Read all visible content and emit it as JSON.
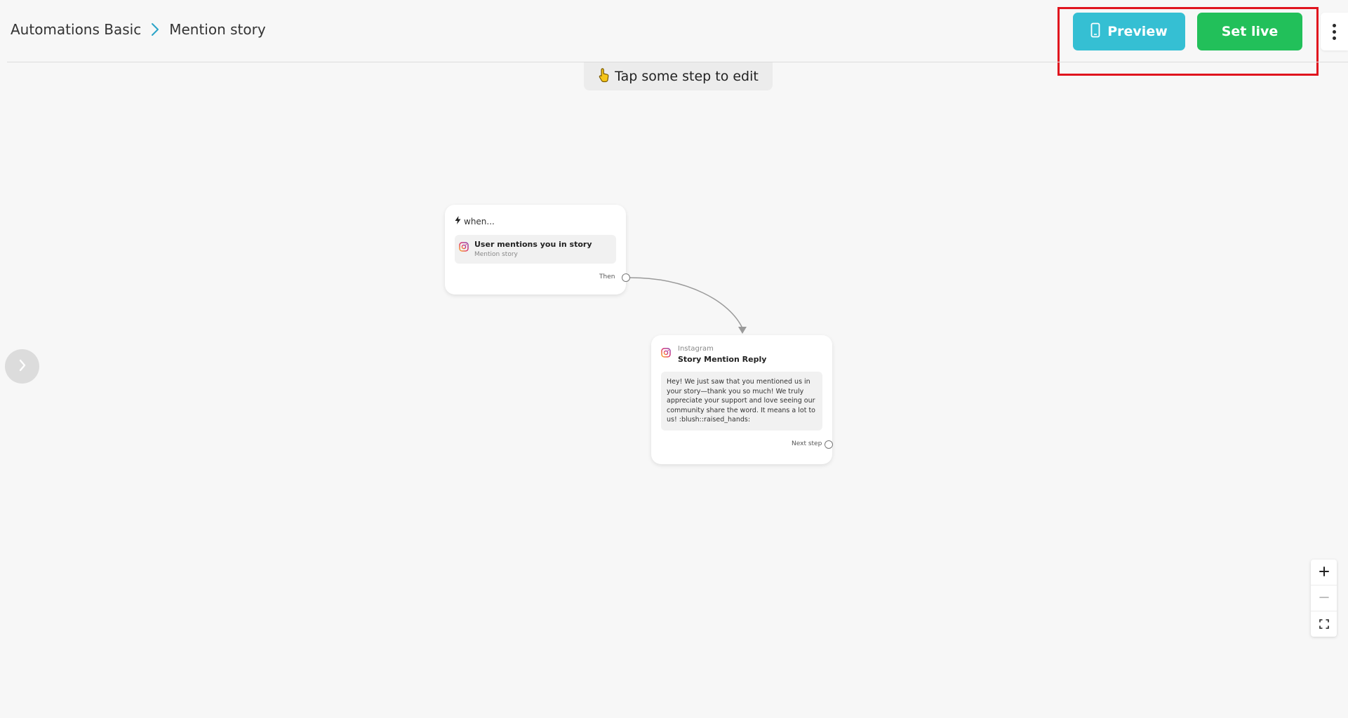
{
  "header": {
    "breadcrumb": {
      "parent": "Automations Basic",
      "current": "Mention story"
    },
    "preview_label": "Preview",
    "set_live_label": "Set live"
  },
  "canvas": {
    "hint": "Tap some step to edit",
    "trigger_card": {
      "when_label": "when...",
      "trigger_title": "User mentions you in story",
      "trigger_subtitle": "Mention story",
      "port_label": "Then"
    },
    "action_card": {
      "kicker": "Instagram",
      "title": "Story Mention Reply",
      "message": "Hey! We just saw that you mentioned us in your story—thank you so much! We truly appreciate your support and love seeing our community share the word. It means a lot to us! :blush::raised_hands:",
      "port_label": "Next step"
    }
  },
  "colors": {
    "preview_button": "#35bfd3",
    "set_live_button": "#22c05a",
    "highlight": "#e0141e",
    "breadcrumb_chevron": "#2aa4c7"
  },
  "icons": {
    "preview": "mobile-phone-icon",
    "hint": "pointing-hand-icon",
    "when": "lightning-bolt-icon",
    "trigger_app": "instagram-icon",
    "action_app": "instagram-icon",
    "sidebar_toggle": "chevron-right-icon",
    "zoom_in": "plus-icon",
    "zoom_out": "minus-icon",
    "fit_view": "fullscreen-icon",
    "more": "more-vertical-icon"
  }
}
